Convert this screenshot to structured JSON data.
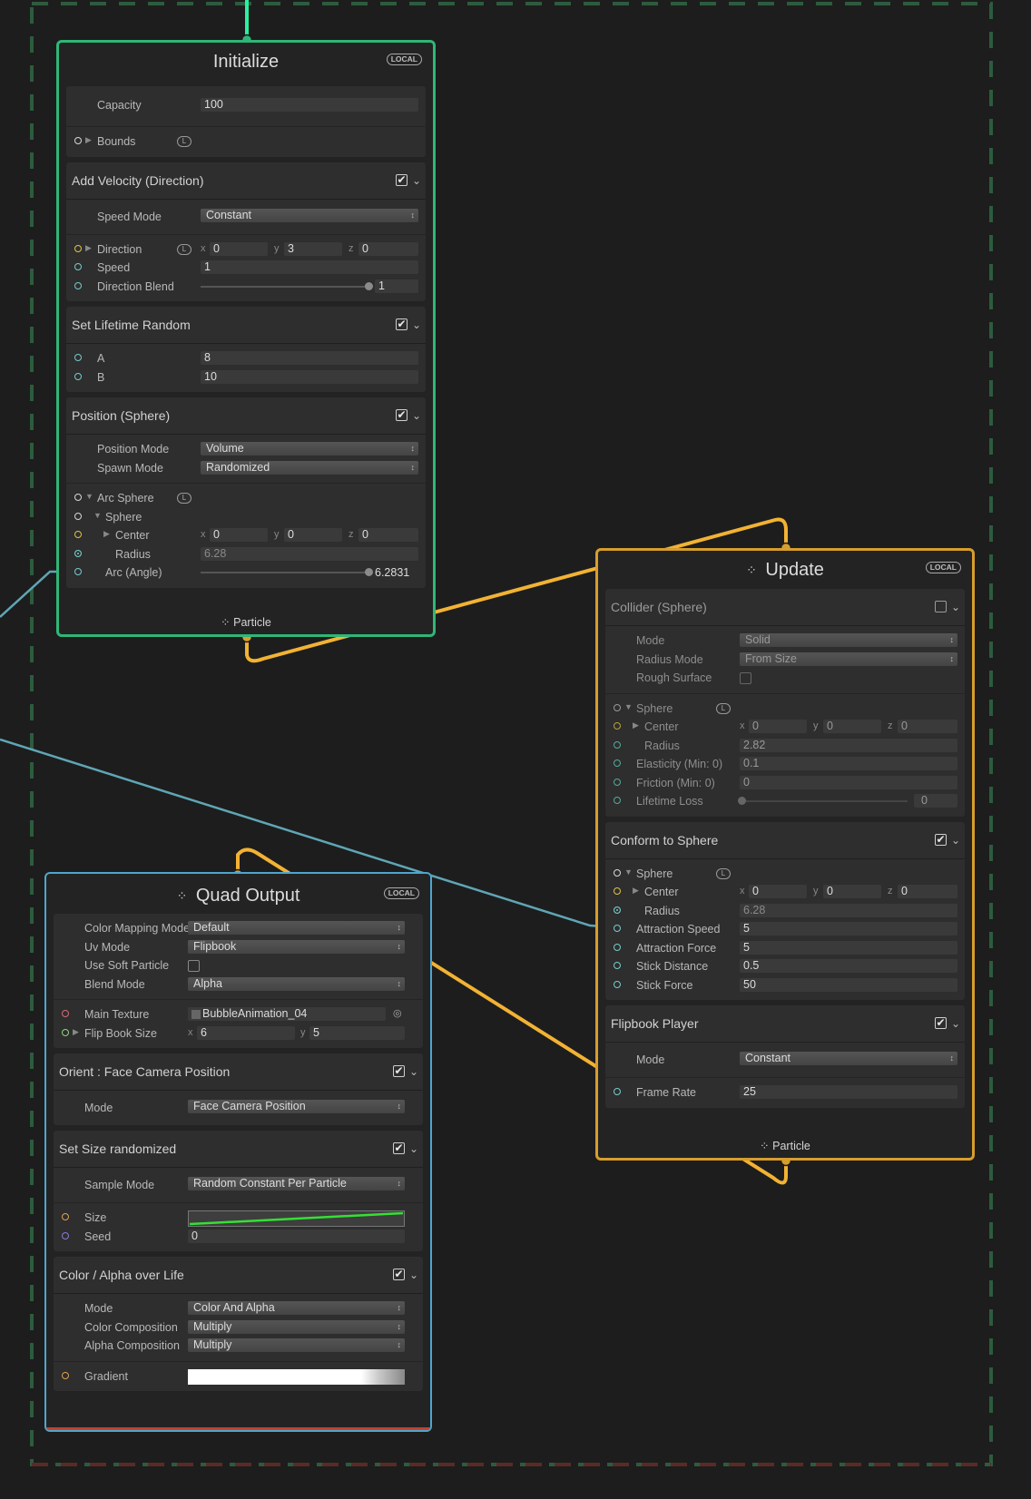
{
  "colors": {
    "init_border": "#2fb777",
    "update_border": "#d79e2d",
    "output_border": "#4ea6cf",
    "flow_edge": "#f2b233",
    "property_edge": "#5fa6b5",
    "system_dash_green": "#2d5b3e",
    "system_dash_red": "#5a2b25"
  },
  "initialize": {
    "title": "Initialize",
    "badge": "LOCAL",
    "footer": "Particle",
    "capacity": {
      "label": "Capacity",
      "value": "100"
    },
    "bounds": {
      "label": "Bounds"
    },
    "add_velocity": {
      "title": "Add Velocity (Direction)",
      "speed_mode": {
        "label": "Speed Mode",
        "value": "Constant"
      },
      "direction": {
        "label": "Direction",
        "x": "0",
        "y": "3",
        "z": "0"
      },
      "speed": {
        "label": "Speed",
        "value": "1"
      },
      "blend": {
        "label": "Direction Blend",
        "value": "1",
        "fraction": 1.0
      }
    },
    "lifetime": {
      "title": "Set Lifetime Random",
      "a": {
        "label": "A",
        "value": "8"
      },
      "b": {
        "label": "B",
        "value": "10"
      }
    },
    "position": {
      "title": "Position (Sphere)",
      "position_mode": {
        "label": "Position Mode",
        "value": "Volume"
      },
      "spawn_mode": {
        "label": "Spawn Mode",
        "value": "Randomized"
      },
      "arc_sphere": {
        "label": "Arc Sphere"
      },
      "sphere": {
        "label": "Sphere"
      },
      "center": {
        "label": "Center",
        "x": "0",
        "y": "0",
        "z": "0"
      },
      "radius": {
        "label": "Radius",
        "value": "6.28"
      },
      "arc": {
        "label": "Arc (Angle)",
        "value": "6.2831",
        "fraction": 1.0
      }
    }
  },
  "update": {
    "title": "Update",
    "badge": "LOCAL",
    "footer": "Particle",
    "collider": {
      "title": "Collider (Sphere)",
      "mode": {
        "label": "Mode",
        "value": "Solid"
      },
      "radius_mode": {
        "label": "Radius Mode",
        "value": "From Size"
      },
      "rough": {
        "label": "Rough Surface"
      },
      "sphere": {
        "label": "Sphere"
      },
      "center": {
        "label": "Center",
        "x": "0",
        "y": "0",
        "z": "0"
      },
      "radius": {
        "label": "Radius",
        "value": "2.82"
      },
      "elasticity": {
        "label": "Elasticity (Min: 0)",
        "value": "0.1"
      },
      "friction": {
        "label": "Friction (Min: 0)",
        "value": "0"
      },
      "lifetime_loss": {
        "label": "Lifetime Loss",
        "value": "0",
        "fraction": 0.0
      }
    },
    "conform": {
      "title": "Conform to Sphere",
      "sphere": {
        "label": "Sphere"
      },
      "center": {
        "label": "Center",
        "x": "0",
        "y": "0",
        "z": "0"
      },
      "radius": {
        "label": "Radius",
        "value": "6.28"
      },
      "attraction_speed": {
        "label": "Attraction Speed",
        "value": "5"
      },
      "attraction_force": {
        "label": "Attraction Force",
        "value": "5"
      },
      "stick_distance": {
        "label": "Stick Distance",
        "value": "0.5"
      },
      "stick_force": {
        "label": "Stick Force",
        "value": "50"
      }
    },
    "flipbook": {
      "title": "Flipbook Player",
      "mode": {
        "label": "Mode",
        "value": "Constant"
      },
      "frame_rate": {
        "label": "Frame Rate",
        "value": "25"
      }
    }
  },
  "quad": {
    "title": "Quad Output",
    "badge": "LOCAL",
    "color_mapping": {
      "label": "Color Mapping Mode",
      "value": "Default"
    },
    "uv_mode": {
      "label": "Uv Mode",
      "value": "Flipbook"
    },
    "soft_particle": {
      "label": "Use Soft Particle"
    },
    "blend_mode": {
      "label": "Blend Mode",
      "value": "Alpha"
    },
    "main_texture": {
      "label": "Main Texture",
      "value": "BubbleAnimation_04"
    },
    "flipbook_size": {
      "label": "Flip Book Size",
      "x": "6",
      "y": "5"
    },
    "orient": {
      "title": "Orient : Face Camera Position",
      "mode": {
        "label": "Mode",
        "value": "Face Camera Position"
      }
    },
    "size": {
      "title": "Set Size randomized",
      "sample_mode": {
        "label": "Sample Mode",
        "value": "Random Constant Per Particle"
      },
      "size": {
        "label": "Size"
      },
      "seed": {
        "label": "Seed",
        "value": "0"
      }
    },
    "color": {
      "title": "Color / Alpha over Life",
      "mode": {
        "label": "Mode",
        "value": "Color And Alpha"
      },
      "color_comp": {
        "label": "Color Composition",
        "value": "Multiply"
      },
      "alpha_comp": {
        "label": "Alpha Composition",
        "value": "Multiply"
      },
      "gradient": {
        "label": "Gradient"
      }
    }
  }
}
